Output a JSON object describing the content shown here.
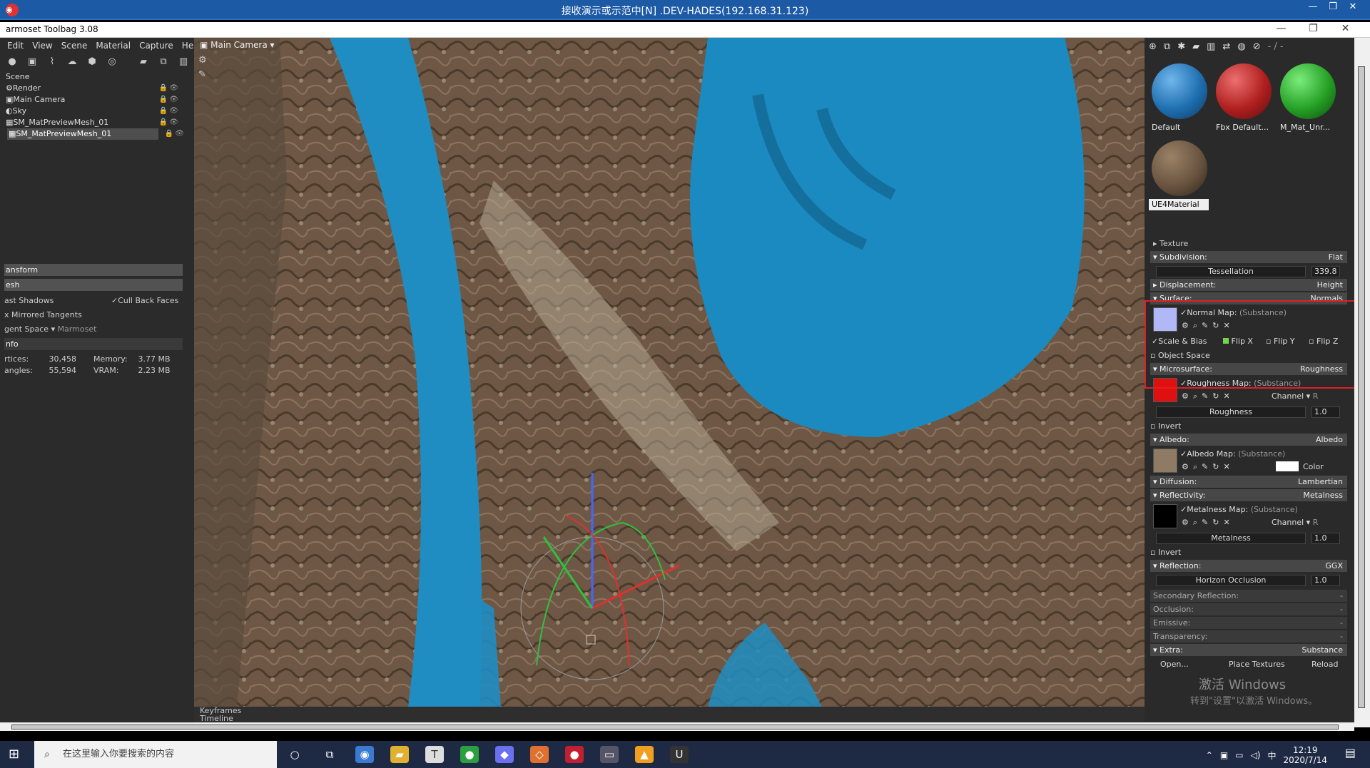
{
  "rdp": {
    "title": "接收演示或示范中[N] .DEV-HADES(192.168.31.123)"
  },
  "app": {
    "title": "armoset Toolbag 3.08"
  },
  "menu": [
    "Edit",
    "View",
    "Scene",
    "Material",
    "Capture",
    "Help"
  ],
  "scene": {
    "items": [
      "Scene",
      "Render",
      "Main Camera",
      "Sky",
      "SM_MatPreviewMesh_01",
      "SM_MatPreviewMesh_01"
    ]
  },
  "props": {
    "transform": "ansform",
    "mesh": "esh",
    "cast_shadows": "ast Shadows",
    "cull": "Cull Back Faces",
    "mirrored": "x Mirrored Tangents",
    "tangent_space": "gent Space",
    "tangent_value": "Marmoset",
    "info": "nfo"
  },
  "stats": {
    "vertices_label": "rtices:",
    "vertices": "30,458",
    "memory_label": "Memory:",
    "memory": "3.77 MB",
    "triangles_label": "angles:",
    "triangles": "55,594",
    "vram_label": "VRAM:",
    "vram": "2.23 MB"
  },
  "viewport": {
    "camera": "Main Camera"
  },
  "timeline": {
    "keyframes": "Keyframes",
    "timeline": "Timeline"
  },
  "materials": [
    {
      "name": "Default",
      "color": "#1f6fb0"
    },
    {
      "name": "Fbx Default...",
      "color": "#b01f1f"
    },
    {
      "name": "M_Mat_Unr...",
      "color": "#25a025"
    },
    {
      "name": "UE4Material",
      "color": "#6a5440"
    }
  ],
  "mat_toolbar_label": "- / -",
  "editor": {
    "texture": "Texture",
    "subdivision": "Subdivision:",
    "subdivision_v": "Flat",
    "tessellation": "Tessellation",
    "tessellation_v": "339.8",
    "displacement": "Displacement:",
    "displacement_v": "Height",
    "surface": "Surface:",
    "surface_v": "Normals",
    "normal_map": "Normal Map:",
    "substance": "(Substance)",
    "scale_bias": "Scale & Bias",
    "flip_x": "Flip X",
    "flip_y": "Flip Y",
    "flip_z": "Flip Z",
    "object_space": "Object Space",
    "micro": "Microsurface:",
    "micro_v": "Roughness",
    "rough_map": "Roughness Map:",
    "channel": "Channel",
    "channel_r": "R",
    "roughness": "Roughness",
    "roughness_v": "1.0",
    "invert": "Invert",
    "albedo": "Albedo:",
    "albedo_v": "Albedo",
    "albedo_map": "Albedo Map:",
    "color": "Color",
    "diffusion": "Diffusion:",
    "diffusion_v": "Lambertian",
    "reflectivity": "Reflectivity:",
    "reflectivity_v": "Metalness",
    "metal_map": "Metalness Map:",
    "metalness": "Metalness",
    "metalness_v": "1.0",
    "reflection": "Reflection:",
    "reflection_v": "GGX",
    "horizon": "Horizon Occlusion",
    "horizon_v": "1.0",
    "secondary": "Secondary Reflection:",
    "occlusion": "Occlusion:",
    "emissive": "Emissive:",
    "transparency": "Transparency:",
    "dash": "-",
    "extra": "Extra:",
    "extra_v": "Substance",
    "open": "Open...",
    "place": "Place Textures",
    "reload": "Reload"
  },
  "watermark": {
    "line1": "激活 Windows",
    "line2": "转到\"设置\"以激活 Windows。"
  },
  "taskbar": {
    "search": "在这里输入你要搜索的内容",
    "time": "12:19",
    "date": "2020/7/14",
    "ime": "中"
  }
}
